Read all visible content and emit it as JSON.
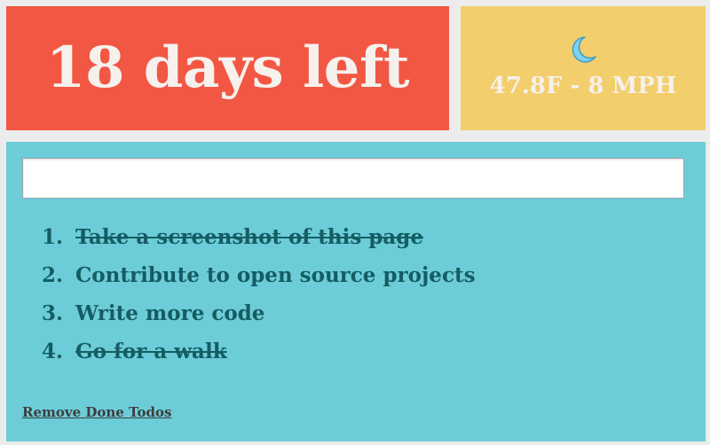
{
  "countdown": {
    "text": "18 days left"
  },
  "weather": {
    "icon": "moon-icon",
    "text": "47.8F - 8 MPH"
  },
  "todo": {
    "input_value": "",
    "items": [
      {
        "number": "1.",
        "label": "Take a screenshot of this page",
        "done": true
      },
      {
        "number": "2.",
        "label": "Contribute to open source projects",
        "done": false
      },
      {
        "number": "3.",
        "label": "Write more code",
        "done": false
      },
      {
        "number": "4.",
        "label": "Go for a walk",
        "done": true
      }
    ],
    "remove_done_label": "Remove Done Todos"
  },
  "colors": {
    "countdown_bg": "#f25744",
    "weather_bg": "#f2ce6c",
    "todo_bg": "#6ccdd9",
    "todo_text": "#155d63",
    "moon": "#7fd2ef"
  }
}
